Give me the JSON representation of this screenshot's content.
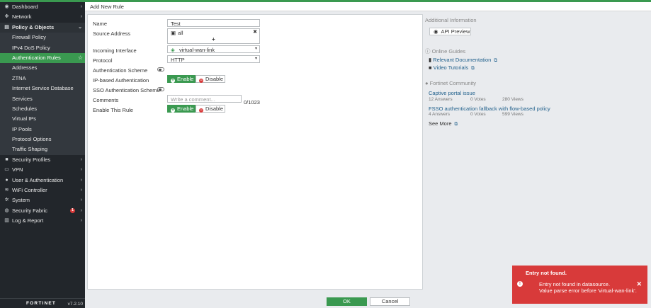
{
  "header": {
    "title": "Add New Rule"
  },
  "sidebar": {
    "items": [
      {
        "label": "Dashboard",
        "icon": "dashboard-icon",
        "chevron": "›"
      },
      {
        "label": "Network",
        "icon": "network-icon",
        "chevron": "›"
      },
      {
        "label": "Policy & Objects",
        "icon": "policy-icon",
        "chevron": "⌄"
      },
      {
        "label": "Firewall Policy"
      },
      {
        "label": "IPv4 DoS Policy"
      },
      {
        "label": "Authentication Rules"
      },
      {
        "label": "Addresses"
      },
      {
        "label": "ZTNA"
      },
      {
        "label": "Internet Service Database"
      },
      {
        "label": "Services"
      },
      {
        "label": "Schedules"
      },
      {
        "label": "Virtual IPs"
      },
      {
        "label": "IP Pools"
      },
      {
        "label": "Protocol Options"
      },
      {
        "label": "Traffic Shaping"
      },
      {
        "label": "Security Profiles",
        "icon": "lock-icon",
        "chevron": "›"
      },
      {
        "label": "VPN",
        "icon": "vpn-icon",
        "chevron": "›"
      },
      {
        "label": "User & Authentication",
        "icon": "user-icon",
        "chevron": "›"
      },
      {
        "label": "WiFi Controller",
        "icon": "wifi-icon",
        "chevron": "›"
      },
      {
        "label": "System",
        "icon": "gear-icon",
        "chevron": "›"
      },
      {
        "label": "Security Fabric",
        "icon": "fabric-icon",
        "chevron": "›",
        "badge": "1"
      },
      {
        "label": "Log & Report",
        "icon": "chart-icon",
        "chevron": "›"
      }
    ],
    "star": "☆",
    "logo": "FORTINET",
    "version": "v7.2.10"
  },
  "form": {
    "name_label": "Name",
    "name_value": "Test",
    "source_label": "Source Address",
    "source_value": "all",
    "source_remove": "✖",
    "source_add": "+",
    "incoming_label": "Incoming Interface",
    "incoming_value": "virtual-wan-link",
    "protocol_label": "Protocol",
    "protocol_value": "HTTP",
    "auth_scheme_label": "Authentication Scheme",
    "ip_auth_label": "IP-based Authentication",
    "sso_label": "SSO Authentication Scheme",
    "comments_label": "Comments",
    "comments_placeholder": "Write a comment...",
    "comments_counter": "0/1023",
    "enable_rule_label": "Enable This Rule",
    "enable_label": "Enable",
    "disable_label": "Disable",
    "caret": "▾"
  },
  "info": {
    "additional_title": "Additional Information",
    "api_preview": "API Preview",
    "online_guides_title": "Online Guides",
    "guide_links": [
      "Relevant Documentation",
      "Video Tutorials"
    ],
    "community_title": "Fortinet Community",
    "posts": [
      {
        "title": "Captive portal issue",
        "answers": "12 Answers",
        "votes": "0 Votes",
        "views": "280 Views"
      },
      {
        "title": "FSSO authentication fallback with flow-based policy",
        "answers": "4 Answers",
        "votes": "0 Votes",
        "views": "599 Views"
      }
    ],
    "see_more": "See More",
    "ext_icon": "⧉"
  },
  "footer": {
    "ok": "OK",
    "cancel": "Cancel"
  },
  "toast": {
    "title": "Entry not found.",
    "line1": "Entry not found in datasource.",
    "line2": "Value parse error before 'virtual-wan-link'.",
    "close": "✕",
    "icon": "!"
  },
  "colors": {
    "accent": "#3a9950",
    "sidebar": "#22262b",
    "error": "#d83a3a",
    "link": "#1f5f8b"
  }
}
